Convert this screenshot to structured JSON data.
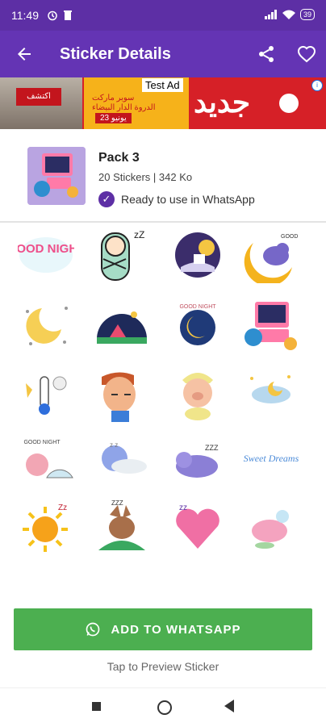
{
  "status_bar": {
    "time": "11:49",
    "battery": "39"
  },
  "app_bar": {
    "title": "Sticker Details"
  },
  "ad": {
    "label": "Test Ad",
    "button": "اكتشف",
    "promo_text": "سوبر ماركت\nالدروة الدار البيضاء",
    "date": "23 يونيو",
    "big_text": "جديد"
  },
  "pack": {
    "name": "Pack 3",
    "meta": "20 Stickers | 342 Ko",
    "status": "Ready to use in WhatsApp"
  },
  "stickers": [
    "good-night-text",
    "sleeping-baby",
    "moon-house",
    "moon-bear",
    "moon-stars",
    "tent-night",
    "moon-good-night",
    "monitor-good-night",
    "thermometer",
    "sleeping-boy",
    "sleeping-pig",
    "cloud-moon",
    "pig-igloo",
    "sleeping-earth",
    "sleeping-hippo",
    "sweet-dreams-text",
    "sleeping-sun",
    "sleeping-rabbit",
    "sleeping-heart",
    "sleeping-pink-creature"
  ],
  "sticker_text": {
    "good_night": "GOOD NIGHT",
    "sweet_dreams": "Sweet Dreams"
  },
  "actions": {
    "add_button": "ADD TO WHATSAPP",
    "hint": "Tap to Preview Sticker"
  }
}
